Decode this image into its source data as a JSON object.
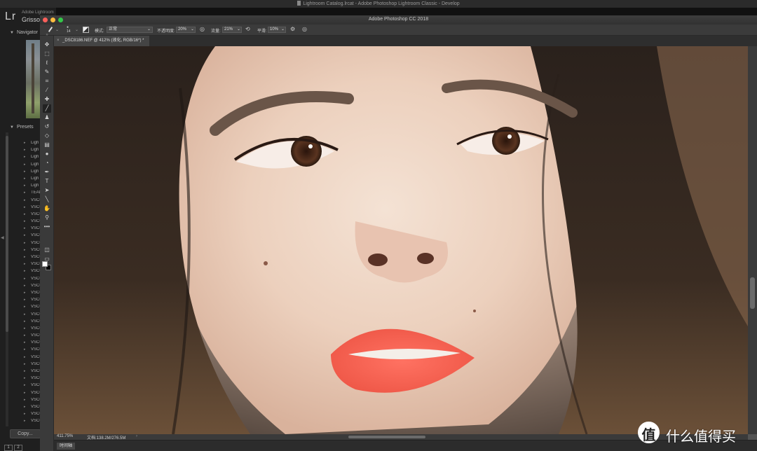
{
  "menubar": {
    "window_title": "Lightroom Catalog.lrcat - Adobe Photoshop Lightroom Classic - Develop"
  },
  "lightroom": {
    "logo": "Lr",
    "catalog_label": "Adobe Lightroom",
    "user_name": "Grisson",
    "navigator_label": "Navigator",
    "presets_label": "Presets",
    "preset_items": [
      "Ligh",
      "Ligh",
      "Ligh",
      "Ligh",
      "Ligh",
      "Ligh",
      "Ligh",
      "TEAL",
      "VSCO",
      "VSCO",
      "VSCO",
      "VSCO",
      "VSCO",
      "VSCO",
      "VSCO",
      "VSCO",
      "VSCO",
      "VSCO",
      "VSCO",
      "VSCO",
      "VSCO",
      "VSCO",
      "VSCO",
      "VSCO",
      "VSCO",
      "VSCO",
      "VSCO",
      "VSCO",
      "VSCO",
      "VSCO",
      "VSCO",
      "VSCO",
      "VSCO",
      "VSCO",
      "VSCO",
      "VSCO",
      "VSCO",
      "VSCO",
      "VSCO",
      "VSCO"
    ],
    "copy_button": "Copy...",
    "page_1": "1",
    "page_2": "2"
  },
  "photoshop": {
    "window_title": "Adobe Photoshop CC 2018",
    "options": {
      "brush_size": "14",
      "mode_label": "模式:",
      "mode_value": "正常",
      "opacity_label": "不透明度:",
      "opacity_value": "20%",
      "flow_label": "流量:",
      "flow_value": "21%",
      "smoothing_label": "平滑:",
      "smoothing_value": "10%"
    },
    "document_tab": "_DSC8186.NEF @ 412% (液化, RGB/16*) *",
    "status": {
      "zoom": "411.75%",
      "doc_info": "文档:138.2M/276.5M"
    },
    "timeline_label": "时间轴",
    "tool_icons": [
      "move-icon",
      "marquee-icon",
      "lasso-icon",
      "quick-select-icon",
      "crop-icon",
      "eyedropper-icon",
      "healing-icon",
      "brush-icon",
      "stamp-icon",
      "history-brush-icon",
      "eraser-icon",
      "gradient-icon",
      "blur-icon",
      "dodge-icon",
      "pen-icon",
      "type-icon",
      "path-select-icon",
      "line-icon",
      "hand-icon",
      "zoom-icon",
      "more-icon"
    ]
  },
  "watermark": {
    "badge": "值",
    "text": "什么值得买"
  },
  "colors": {
    "ps_bg": "#535353",
    "lr_bg": "#1f1f1f",
    "close": "#fc605b",
    "minimize": "#fdbc40",
    "zoom": "#34c84a",
    "lip": "#f05a4a"
  }
}
